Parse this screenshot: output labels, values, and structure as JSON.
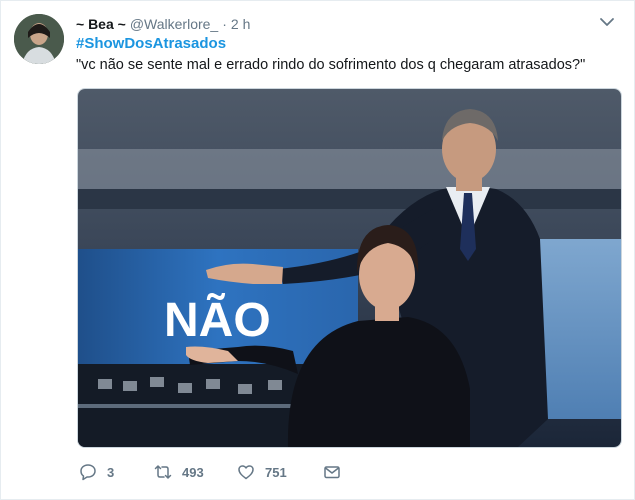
{
  "tweet": {
    "author_name": "~ Bea ~",
    "handle": "@Walkerlore_",
    "separator": "·",
    "time": "2 h",
    "hashtag": "#ShowDosAtrasados",
    "text": "\"vc não se sente mal e errado rindo do sofrimento dos q chegaram atrasados?\"",
    "image_caption_text": "NÃO"
  },
  "actions": {
    "reply_count": "3",
    "retweet_count": "493",
    "like_count": "751"
  },
  "icons": {
    "reply": "reply-icon",
    "retweet": "retweet-icon",
    "like": "heart-icon",
    "dm": "envelope-icon",
    "menu": "chevron-down-icon"
  },
  "colors": {
    "accent": "#1b95e0",
    "muted": "#657786",
    "text": "#14171a"
  }
}
